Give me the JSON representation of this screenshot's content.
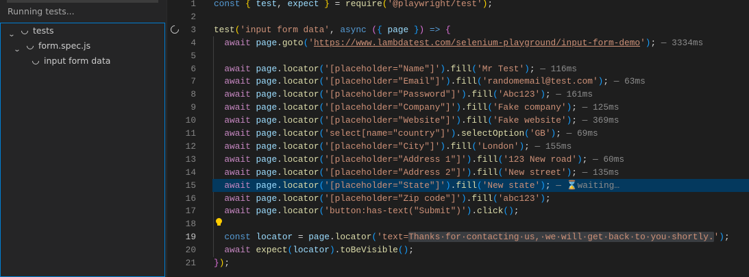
{
  "sidebar": {
    "status": "Running tests...",
    "tree": [
      {
        "label": "tests",
        "expanded": true,
        "level": 0
      },
      {
        "label": "form.spec.js",
        "expanded": true,
        "level": 1
      },
      {
        "label": "input form data",
        "level": 2
      }
    ]
  },
  "editor": {
    "current_line": 19,
    "highlighted_line": 15,
    "lines": [
      [
        [
          "s",
          "const "
        ],
        [
          "b1",
          "{ "
        ],
        [
          "v",
          "test"
        ],
        [
          "p",
          ", "
        ],
        [
          "v",
          "expect "
        ],
        [
          "b1",
          "}"
        ],
        [
          "p",
          " = "
        ],
        [
          "f",
          "require"
        ],
        [
          "b1",
          "("
        ],
        [
          "str",
          "'@playwright/test'"
        ],
        [
          "b1",
          ")"
        ],
        [
          "p",
          ";"
        ]
      ],
      [],
      [
        [
          "f",
          "test"
        ],
        [
          "b1",
          "("
        ],
        [
          "str",
          "'input form data'"
        ],
        [
          "p",
          ", "
        ],
        [
          "s",
          "async "
        ],
        [
          "b2",
          "("
        ],
        [
          "b3",
          "{ "
        ],
        [
          "v",
          "page "
        ],
        [
          "b3",
          "}"
        ],
        [
          "b2",
          ")"
        ],
        [
          "s",
          " => "
        ],
        [
          "b2",
          "{"
        ]
      ],
      [
        [
          "p",
          "  "
        ],
        [
          "k",
          "await "
        ],
        [
          "v",
          "page"
        ],
        [
          "p",
          "."
        ],
        [
          "f",
          "goto"
        ],
        [
          "b3",
          "("
        ],
        [
          "str",
          "'"
        ],
        [
          "stru",
          "https://www.lambdatest.com/selenium-playground/input-form-demo"
        ],
        [
          "str",
          "'"
        ],
        [
          "b3",
          ")"
        ],
        [
          "p",
          ";"
        ],
        [
          "d",
          " — 3334ms"
        ]
      ],
      [],
      [
        [
          "p",
          "  "
        ],
        [
          "k",
          "await "
        ],
        [
          "v",
          "page"
        ],
        [
          "p",
          "."
        ],
        [
          "f",
          "locator"
        ],
        [
          "b3",
          "("
        ],
        [
          "str",
          "'[placeholder=\"Name\"]'"
        ],
        [
          "b3",
          ")"
        ],
        [
          "p",
          "."
        ],
        [
          "f",
          "fill"
        ],
        [
          "b3",
          "("
        ],
        [
          "str",
          "'Mr Test'"
        ],
        [
          "b3",
          ")"
        ],
        [
          "p",
          ";"
        ],
        [
          "d",
          " — 116ms"
        ]
      ],
      [
        [
          "p",
          "  "
        ],
        [
          "k",
          "await "
        ],
        [
          "v",
          "page"
        ],
        [
          "p",
          "."
        ],
        [
          "f",
          "locator"
        ],
        [
          "b3",
          "("
        ],
        [
          "str",
          "'[placeholder=\"Email\"]'"
        ],
        [
          "b3",
          ")"
        ],
        [
          "p",
          "."
        ],
        [
          "f",
          "fill"
        ],
        [
          "b3",
          "("
        ],
        [
          "str",
          "'randomemail@test.com'"
        ],
        [
          "b3",
          ")"
        ],
        [
          "p",
          ";"
        ],
        [
          "d",
          " — 63ms"
        ]
      ],
      [
        [
          "p",
          "  "
        ],
        [
          "k",
          "await "
        ],
        [
          "v",
          "page"
        ],
        [
          "p",
          "."
        ],
        [
          "f",
          "locator"
        ],
        [
          "b3",
          "("
        ],
        [
          "str",
          "'[placeholder=\"Password\"]'"
        ],
        [
          "b3",
          ")"
        ],
        [
          "p",
          "."
        ],
        [
          "f",
          "fill"
        ],
        [
          "b3",
          "("
        ],
        [
          "str",
          "'Abc123'"
        ],
        [
          "b3",
          ")"
        ],
        [
          "p",
          ";"
        ],
        [
          "d",
          " — 161ms"
        ]
      ],
      [
        [
          "p",
          "  "
        ],
        [
          "k",
          "await "
        ],
        [
          "v",
          "page"
        ],
        [
          "p",
          "."
        ],
        [
          "f",
          "locator"
        ],
        [
          "b3",
          "("
        ],
        [
          "str",
          "'[placeholder=\"Company\"]'"
        ],
        [
          "b3",
          ")"
        ],
        [
          "p",
          "."
        ],
        [
          "f",
          "fill"
        ],
        [
          "b3",
          "("
        ],
        [
          "str",
          "'Fake company'"
        ],
        [
          "b3",
          ")"
        ],
        [
          "p",
          ";"
        ],
        [
          "d",
          " — 125ms"
        ]
      ],
      [
        [
          "p",
          "  "
        ],
        [
          "k",
          "await "
        ],
        [
          "v",
          "page"
        ],
        [
          "p",
          "."
        ],
        [
          "f",
          "locator"
        ],
        [
          "b3",
          "("
        ],
        [
          "str",
          "'[placeholder=\"Website\"]'"
        ],
        [
          "b3",
          ")"
        ],
        [
          "p",
          "."
        ],
        [
          "f",
          "fill"
        ],
        [
          "b3",
          "("
        ],
        [
          "str",
          "'Fake website'"
        ],
        [
          "b3",
          ")"
        ],
        [
          "p",
          ";"
        ],
        [
          "d",
          " — 369ms"
        ]
      ],
      [
        [
          "p",
          "  "
        ],
        [
          "k",
          "await "
        ],
        [
          "v",
          "page"
        ],
        [
          "p",
          "."
        ],
        [
          "f",
          "locator"
        ],
        [
          "b3",
          "("
        ],
        [
          "str",
          "'select[name=\"country\"]'"
        ],
        [
          "b3",
          ")"
        ],
        [
          "p",
          "."
        ],
        [
          "f",
          "selectOption"
        ],
        [
          "b3",
          "("
        ],
        [
          "str",
          "'GB'"
        ],
        [
          "b3",
          ")"
        ],
        [
          "p",
          ";"
        ],
        [
          "d",
          " — 69ms"
        ]
      ],
      [
        [
          "p",
          "  "
        ],
        [
          "k",
          "await "
        ],
        [
          "v",
          "page"
        ],
        [
          "p",
          "."
        ],
        [
          "f",
          "locator"
        ],
        [
          "b3",
          "("
        ],
        [
          "str",
          "'[placeholder=\"City\"]'"
        ],
        [
          "b3",
          ")"
        ],
        [
          "p",
          "."
        ],
        [
          "f",
          "fill"
        ],
        [
          "b3",
          "("
        ],
        [
          "str",
          "'London'"
        ],
        [
          "b3",
          ")"
        ],
        [
          "p",
          ";"
        ],
        [
          "d",
          " — 155ms"
        ]
      ],
      [
        [
          "p",
          "  "
        ],
        [
          "k",
          "await "
        ],
        [
          "v",
          "page"
        ],
        [
          "p",
          "."
        ],
        [
          "f",
          "locator"
        ],
        [
          "b3",
          "("
        ],
        [
          "str",
          "'[placeholder=\"Address 1\"]'"
        ],
        [
          "b3",
          ")"
        ],
        [
          "p",
          "."
        ],
        [
          "f",
          "fill"
        ],
        [
          "b3",
          "("
        ],
        [
          "str",
          "'123 New road'"
        ],
        [
          "b3",
          ")"
        ],
        [
          "p",
          ";"
        ],
        [
          "d",
          " — 60ms"
        ]
      ],
      [
        [
          "p",
          "  "
        ],
        [
          "k",
          "await "
        ],
        [
          "v",
          "page"
        ],
        [
          "p",
          "."
        ],
        [
          "f",
          "locator"
        ],
        [
          "b3",
          "("
        ],
        [
          "str",
          "'[placeholder=\"Address 2\"]'"
        ],
        [
          "b3",
          ")"
        ],
        [
          "p",
          "."
        ],
        [
          "f",
          "fill"
        ],
        [
          "b3",
          "("
        ],
        [
          "str",
          "'New street'"
        ],
        [
          "b3",
          ")"
        ],
        [
          "p",
          ";"
        ],
        [
          "d",
          " — 135ms"
        ]
      ],
      [
        [
          "p",
          "  "
        ],
        [
          "k",
          "await "
        ],
        [
          "v",
          "page"
        ],
        [
          "p",
          "."
        ],
        [
          "f",
          "locator"
        ],
        [
          "b3",
          "("
        ],
        [
          "str",
          "'[placeholder=\"State\"]'"
        ],
        [
          "b3",
          ")"
        ],
        [
          "p",
          "."
        ],
        [
          "f",
          "fill"
        ],
        [
          "b3",
          "("
        ],
        [
          "str",
          "'New state'"
        ],
        [
          "b3",
          ")"
        ],
        [
          "p",
          ";"
        ],
        [
          "d",
          " — "
        ],
        [
          "hour",
          "⌛"
        ],
        [
          "d",
          "waiting…"
        ]
      ],
      [
        [
          "p",
          "  "
        ],
        [
          "k",
          "await "
        ],
        [
          "v",
          "page"
        ],
        [
          "p",
          "."
        ],
        [
          "f",
          "locator"
        ],
        [
          "b3",
          "("
        ],
        [
          "str",
          "'[placeholder=\"Zip code\"]'"
        ],
        [
          "b3",
          ")"
        ],
        [
          "p",
          "."
        ],
        [
          "f",
          "fill"
        ],
        [
          "b3",
          "("
        ],
        [
          "str",
          "'abc123'"
        ],
        [
          "b3",
          ")"
        ],
        [
          "p",
          ";"
        ]
      ],
      [
        [
          "p",
          "  "
        ],
        [
          "k",
          "await "
        ],
        [
          "v",
          "page"
        ],
        [
          "p",
          "."
        ],
        [
          "f",
          "locator"
        ],
        [
          "b3",
          "("
        ],
        [
          "str",
          "'button:has-text(\"Submit\")'"
        ],
        [
          "b3",
          ")"
        ],
        [
          "p",
          "."
        ],
        [
          "f",
          "click"
        ],
        [
          "b3",
          "()"
        ],
        [
          "p",
          ";"
        ]
      ],
      [],
      [
        [
          "p",
          "  "
        ],
        [
          "s",
          "const "
        ],
        [
          "v",
          "locator"
        ],
        [
          "p",
          " = "
        ],
        [
          "v",
          "page"
        ],
        [
          "p",
          "."
        ],
        [
          "f",
          "locator"
        ],
        [
          "b3",
          "("
        ],
        [
          "str",
          "'text="
        ],
        [
          "strg",
          "Thanks·for·contacting·us,·we·will·get·back·to·you·shortly."
        ],
        [
          "str",
          "'"
        ],
        [
          "b3",
          ")"
        ],
        [
          "p",
          ";"
        ]
      ],
      [
        [
          "p",
          "  "
        ],
        [
          "k",
          "await "
        ],
        [
          "f",
          "expect"
        ],
        [
          "b3",
          "("
        ],
        [
          "v",
          "locator"
        ],
        [
          "b3",
          ")"
        ],
        [
          "p",
          "."
        ],
        [
          "f",
          "toBeVisible"
        ],
        [
          "b3",
          "()"
        ],
        [
          "p",
          ";"
        ]
      ],
      [
        [
          "b2",
          "}"
        ],
        [
          "b1",
          ")"
        ],
        [
          "p",
          ";"
        ]
      ]
    ]
  }
}
